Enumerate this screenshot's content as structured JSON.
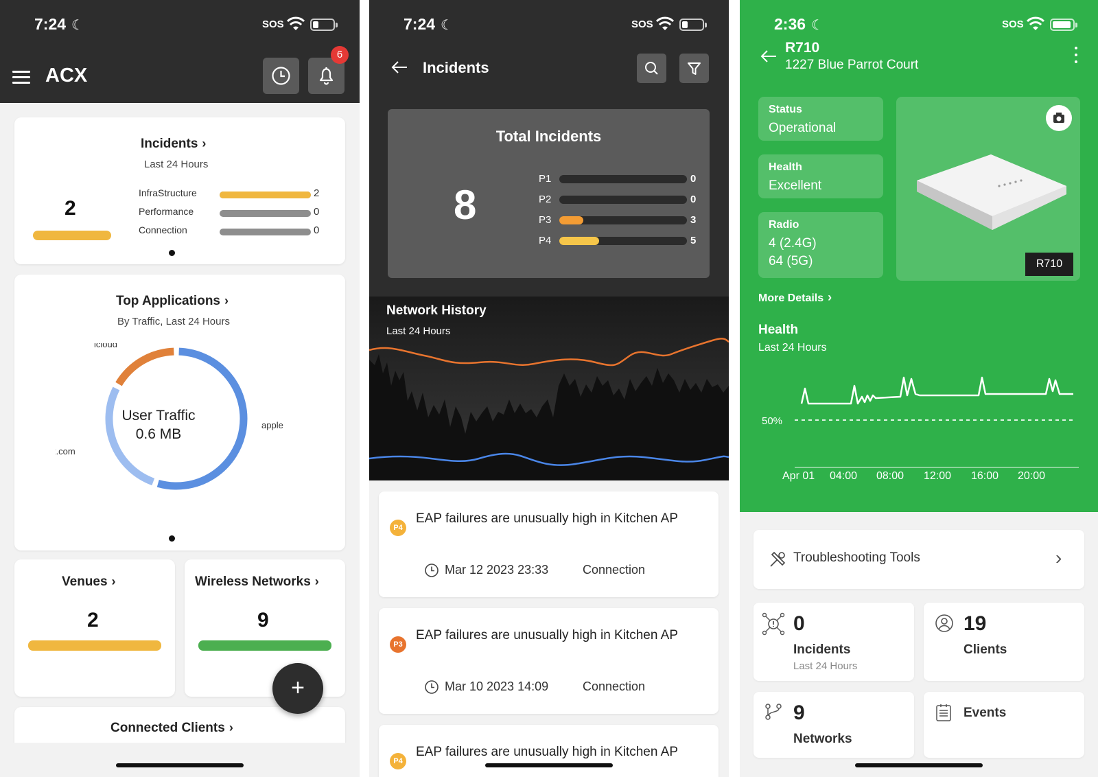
{
  "phone1": {
    "status": {
      "time": "7:24",
      "sos": "SOS"
    },
    "header": {
      "title": "ACX",
      "notification_count": "6"
    },
    "incidents_card": {
      "title": "Incidents",
      "subtitle": "Last 24 Hours",
      "total": "2",
      "rows": [
        {
          "label": "InfraStructure",
          "value": "2",
          "fraction": 1.0
        },
        {
          "label": "Performance",
          "value": "0",
          "fraction": 0
        },
        {
          "label": "Connection",
          "value": "0",
          "fraction": 0
        }
      ]
    },
    "apps_card": {
      "title": "Top Applications",
      "subtitle": "By Traffic, Last 24 Hours",
      "center_line1": "User Traffic",
      "center_line2": "0.6 MB",
      "segments": [
        {
          "label": "apple",
          "fraction": 0.55,
          "color": "#5b8fe0"
        },
        {
          "label": "nest.com",
          "fraction": 0.28,
          "color": "#9dbdf0"
        },
        {
          "label": "icloud",
          "fraction": 0.17,
          "color": "#e0813a"
        }
      ]
    },
    "venues_card": {
      "title": "Venues",
      "value": "2",
      "bar_color": "#f0b73f"
    },
    "wireless_card": {
      "title": "Wireless Networks",
      "value": "9",
      "bar_color": "#4caf50"
    },
    "fab_label": "+",
    "connected_card": {
      "title": "Connected Clients"
    }
  },
  "phone2": {
    "status": {
      "time": "7:24",
      "sos": "SOS"
    },
    "header": {
      "title": "Incidents"
    },
    "total": {
      "title": "Total Incidents",
      "value": "8",
      "priorities": [
        {
          "label": "P1",
          "value": "0",
          "fraction": 0,
          "color": "#f39c34"
        },
        {
          "label": "P2",
          "value": "0",
          "fraction": 0,
          "color": "#f39c34"
        },
        {
          "label": "P3",
          "value": "3",
          "fraction": 0.19,
          "color": "#f39c34"
        },
        {
          "label": "P4",
          "value": "5",
          "fraction": 0.31,
          "color": "#f6c64a"
        }
      ]
    },
    "history": {
      "title": "Network History",
      "subtitle": "Last 24 Hours"
    },
    "incidents": [
      {
        "badge": "P4",
        "badge_color": "#f4b23a",
        "title": "EAP failures are unusually high in Kitchen AP",
        "date": "Mar 12 2023 23:33",
        "category": "Connection"
      },
      {
        "badge": "P3",
        "badge_color": "#e8742e",
        "title": "EAP failures are unusually high in Kitchen AP",
        "date": "Mar 10 2023 14:09",
        "category": "Connection"
      },
      {
        "badge": "P4",
        "badge_color": "#f4b23a",
        "title": "EAP failures are unusually high in Kitchen AP"
      }
    ]
  },
  "phone3": {
    "status": {
      "time": "2:36",
      "sos": "SOS"
    },
    "header": {
      "name": "R710",
      "address": "1227 Blue Parrot Court"
    },
    "tiles": [
      {
        "label": "Status",
        "value": "Operational"
      },
      {
        "label": "Health",
        "value": "Excellent"
      },
      {
        "label": "Radio",
        "value": "4 (2.4G)",
        "value2": "64 (5G)"
      }
    ],
    "model_tag": "R710",
    "more_details": "More Details",
    "health": {
      "title": "Health",
      "subtitle": "Last 24 Hours",
      "threshold_label": "50%",
      "x_ticks": [
        "Apr 01",
        "04:00",
        "08:00",
        "12:00",
        "16:00",
        "20:00"
      ]
    },
    "troubleshooting": "Troubleshooting Tools",
    "stats": {
      "incidents": {
        "value": "0",
        "label": "Incidents",
        "sub": "Last 24 Hours"
      },
      "clients": {
        "value": "19",
        "label": "Clients"
      },
      "networks": {
        "value": "9",
        "label": "Networks"
      },
      "events": {
        "label": "Events"
      }
    }
  }
}
